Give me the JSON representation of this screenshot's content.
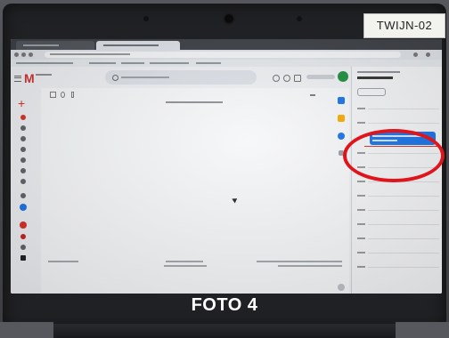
{
  "photo": {
    "sticker_text": "TWIJN-02",
    "caption": "FOTO 4",
    "highlight_color": "#e0141b"
  },
  "gmail": {
    "logo_letter": "M",
    "accent_color": "#d0312d"
  },
  "calendar": {
    "event_color": "#1a73e8"
  },
  "icons": {
    "webcam": "webcam-icon",
    "menu": "hamburger-menu-icon",
    "search": "search-icon",
    "compose": "plus-icon",
    "cursor": "mouse-pointer-icon"
  }
}
